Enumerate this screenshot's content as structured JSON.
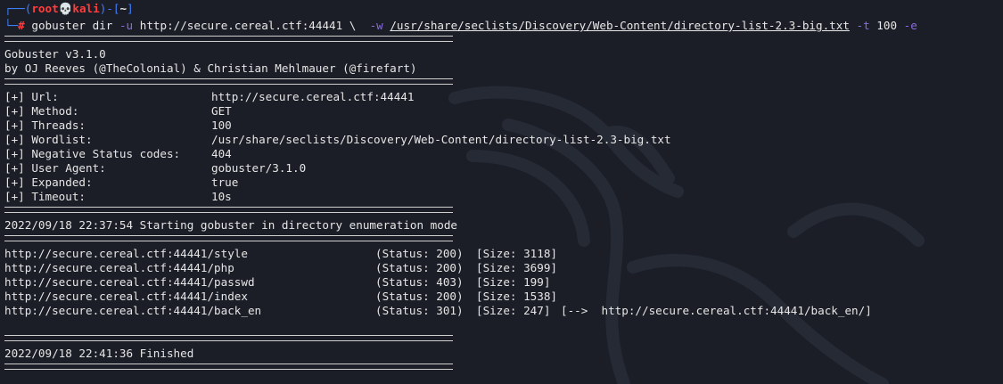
{
  "prompt": {
    "corner_top": "┌──(",
    "user": "root",
    "skull_glyph": "💀",
    "host": "kali",
    "sep": ")-[",
    "dir": "~",
    "close": "]",
    "corner_bottom": "└─",
    "hash": "#"
  },
  "command": {
    "program": "gobuster",
    "subcommand": "dir",
    "url_flag": "-u",
    "url": "http://secure.cereal.ctf:44441",
    "continuation": "\\",
    "wordlist_flag": "-w",
    "wordlist": "/usr/share/seclists/Discovery/Web-Content/directory-list-2.3-big.txt",
    "threads_flag": "-t",
    "threads": "100",
    "expanded_flag": "-e"
  },
  "banner": {
    "version": "Gobuster v3.1.0",
    "credits": "by OJ Reeves (@TheColonial) & Christian Mehlmauer (@firefart)"
  },
  "config": [
    {
      "key": "[+] Url:",
      "value": "http://secure.cereal.ctf:44441"
    },
    {
      "key": "[+] Method:",
      "value": "GET"
    },
    {
      "key": "[+] Threads:",
      "value": "100"
    },
    {
      "key": "[+] Wordlist:",
      "value": "/usr/share/seclists/Discovery/Web-Content/directory-list-2.3-big.txt"
    },
    {
      "key": "[+] Negative Status codes:",
      "value": "404"
    },
    {
      "key": "[+] User Agent:",
      "value": "gobuster/3.1.0"
    },
    {
      "key": "[+] Expanded:",
      "value": "true"
    },
    {
      "key": "[+] Timeout:",
      "value": "10s"
    }
  ],
  "start_message": "2022/09/18 22:37:54 Starting gobuster in directory enumeration mode",
  "results": [
    {
      "url": "http://secure.cereal.ctf:44441/style",
      "status": "(Status: 200)",
      "size": "[Size: 3118]",
      "redirect": ""
    },
    {
      "url": "http://secure.cereal.ctf:44441/php",
      "status": "(Status: 200)",
      "size": "[Size: 3699]",
      "redirect": ""
    },
    {
      "url": "http://secure.cereal.ctf:44441/passwd",
      "status": "(Status: 403)",
      "size": "[Size: 199]",
      "redirect": ""
    },
    {
      "url": "http://secure.cereal.ctf:44441/index",
      "status": "(Status: 200)",
      "size": "[Size: 1538]",
      "redirect": ""
    },
    {
      "url": "http://secure.cereal.ctf:44441/back_en",
      "status": "(Status: 301)",
      "size": "[Size: 247]",
      "redirect": "[-->  http://secure.cereal.ctf:44441/back_en/]"
    }
  ],
  "finish_message": "2022/09/18 22:41:36 Finished",
  "colors": {
    "background": "#1b1e27",
    "prompt_frame": "#3f7fff",
    "prompt_user": "#ff3d3d",
    "flags": "#8b6be0",
    "text": "#e6e6e6"
  }
}
